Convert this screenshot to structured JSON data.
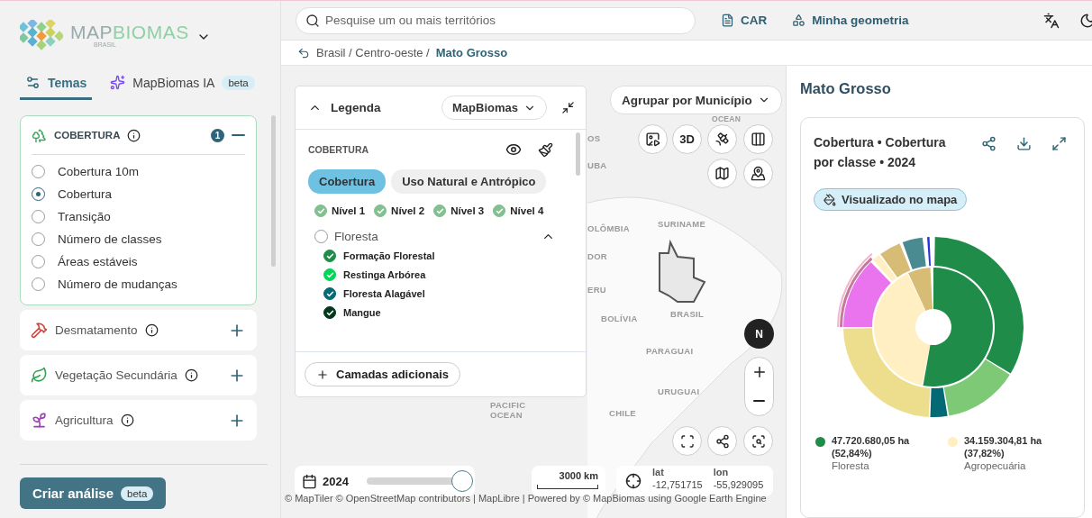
{
  "brand": {
    "part1": "MAP",
    "part2": "BIOMAS",
    "subtitle": "BRASIL"
  },
  "sidebar_tabs": [
    {
      "label": "Temas",
      "kind": "temas",
      "selected": true
    },
    {
      "label": "MapBiomas IA",
      "kind": "ia",
      "badge": "beta",
      "selected": false
    }
  ],
  "themes": [
    {
      "title": "COBERTURA",
      "kind": "cobertura",
      "expanded": true,
      "count": "1",
      "options": [
        {
          "label": "Cobertura 10m",
          "selected": false
        },
        {
          "label": "Cobertura",
          "selected": true
        },
        {
          "label": "Transição",
          "selected": false
        },
        {
          "label": "Número de classes",
          "selected": false
        },
        {
          "label": "Áreas estáveis",
          "selected": false
        },
        {
          "label": "Número de mudanças",
          "selected": false
        }
      ]
    },
    {
      "title": "Desmatamento",
      "kind": "desmatamento",
      "expanded": false
    },
    {
      "title": "Vegetação Secundária",
      "kind": "vegetacao",
      "expanded": false
    },
    {
      "title": "Agricultura",
      "kind": "agricultura",
      "expanded": false
    }
  ],
  "create_button": {
    "label": "Criar análise",
    "badge": "beta"
  },
  "topbar": {
    "search_placeholder": "Pesquise um ou mais territórios",
    "links": [
      {
        "label": "CAR",
        "kind": "document"
      },
      {
        "label": "Minha geometria",
        "kind": "geometry"
      }
    ]
  },
  "breadcrumb": {
    "path": "Brasil / Centro-oeste /",
    "current": "Mato Grosso"
  },
  "legend": {
    "title": "Legenda",
    "expanded": true,
    "source": "MapBiomas",
    "section": "COBERTURA",
    "tabs": [
      {
        "label": "Cobertura",
        "selected": true
      },
      {
        "label": "Uso Natural e Antrópico",
        "selected": false
      }
    ],
    "levels": [
      {
        "label": "Nível 1",
        "checked": true
      },
      {
        "label": "Nível 2",
        "checked": true
      },
      {
        "label": "Nível 3",
        "checked": true
      },
      {
        "label": "Nível 4",
        "checked": true
      }
    ],
    "groups": [
      {
        "label": "Floresta",
        "checked": false,
        "expanded": true,
        "classes": [
          {
            "label": "Formação Florestal",
            "color": "#1f8d49",
            "checked": true
          },
          {
            "label": "Restinga Arbórea",
            "color": "#02d659",
            "checked": true
          },
          {
            "label": "Floresta Alagável",
            "color": "#026975",
            "checked": true
          },
          {
            "label": "Mangue",
            "color": "#04381d",
            "checked": true
          }
        ]
      }
    ],
    "add_layers": "Camadas adicionais"
  },
  "map": {
    "group_by": "Agrupar por Município",
    "tools": [
      {
        "kind": "image"
      },
      {
        "kind": "terrain",
        "label": "3D"
      },
      {
        "kind": "satellite"
      },
      {
        "kind": "columns"
      },
      {
        "kind": "map"
      },
      {
        "kind": "pin"
      }
    ],
    "labels": [
      "OCEAN",
      "OS",
      "UBA",
      "OLÔMBIA",
      "SURINAME",
      "DOR",
      "ERU",
      "BOLÍVIA",
      "BRASIL",
      "PARAGUAI",
      "URUGUAI",
      "CHILE",
      "PACIFIC",
      "OCEAN"
    ],
    "compass": "N"
  },
  "timeline": {
    "year": "2024",
    "level": 1
  },
  "scale": "3000 km",
  "coords": {
    "lat_label": "lat",
    "lat": "-12,751715",
    "lon_label": "lon",
    "lon": "-55,929095"
  },
  "attribution": "© MapTiler © OpenStreetMap contributors | MapLibre | Powered by © MapBiomas using Google Earth Engine",
  "panel": {
    "title": "Mato Grosso",
    "card": {
      "title": "Cobertura • Cobertura por classe • 2024",
      "badge": "Visualizado no mapa",
      "legend": [
        {
          "value": "47.720.680,05 ha (52,84%)",
          "label": "Floresta",
          "color": "#1f8d49"
        },
        {
          "value": "34.159.304,81 ha (37,82%)",
          "label": "Agropecuária",
          "color": "#ffefc3"
        }
      ]
    }
  }
}
